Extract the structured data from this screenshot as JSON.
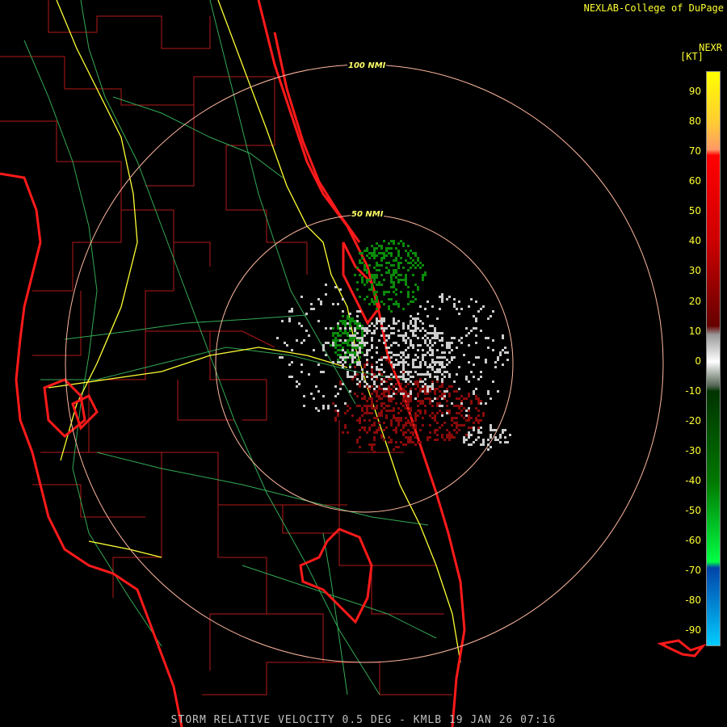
{
  "header": {
    "credit": "NEXLAB-College of DuPage"
  },
  "footer": {
    "product": "STORM RELATIVE VELOCITY 0.5 DEG - KMLB 19 JAN 26 07:16"
  },
  "range_rings": [
    {
      "label": "100 NMI"
    },
    {
      "label": "50 NMI"
    }
  ],
  "legend": {
    "title": "NEXR",
    "unit": "[KT]",
    "ticks": [
      "90",
      "80",
      "70",
      "60",
      "50",
      "40",
      "30",
      "20",
      "10",
      "0",
      "-10",
      "-20",
      "-30",
      "-40",
      "-50",
      "-60",
      "-70",
      "-80",
      "-90"
    ],
    "scale_min": -95,
    "scale_max": 97,
    "stops": [
      {
        "value": 97,
        "color": "#ffff00"
      },
      {
        "value": 80,
        "color": "#ffcc33"
      },
      {
        "value": 71,
        "color": "#ff9966"
      },
      {
        "value": 69,
        "color": "#ff0000"
      },
      {
        "value": 40,
        "color": "#cc0000"
      },
      {
        "value": 12,
        "color": "#660000"
      },
      {
        "value": 9,
        "color": "#999999"
      },
      {
        "value": 0,
        "color": "#ffffff"
      },
      {
        "value": -8,
        "color": "#556655"
      },
      {
        "value": -10,
        "color": "#003300"
      },
      {
        "value": -40,
        "color": "#007700"
      },
      {
        "value": -67,
        "color": "#00ff44"
      },
      {
        "value": -69,
        "color": "#0044aa"
      },
      {
        "value": -95,
        "color": "#00ccff"
      }
    ]
  },
  "colors": {
    "coast": "#ff1a1a",
    "county": "#b31a1a",
    "road": "#33aa55",
    "interstate": "#ffff33",
    "ring": "#ffb8a0",
    "inbound": "#0a8a0a",
    "outbound": "#8a0a0a",
    "near_zero": "#cccccc"
  }
}
